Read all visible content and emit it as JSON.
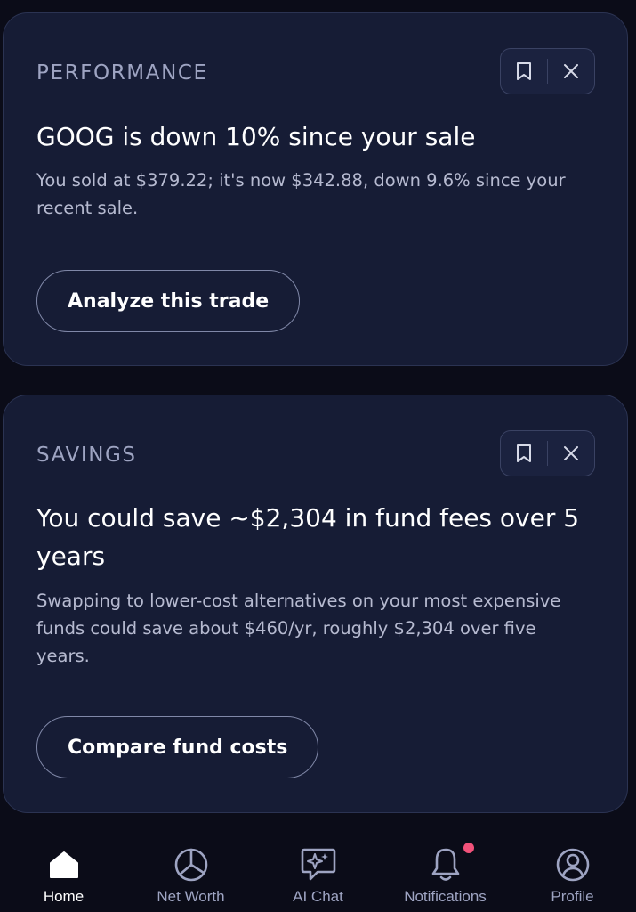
{
  "cards": [
    {
      "category": "PERFORMANCE",
      "title": "GOOG is down 10% since your sale",
      "body": "You sold at $379.22; it's now $342.88, down 9.6% since your recent sale.",
      "action_label": "Analyze this trade",
      "icons": [
        "bookmark-icon",
        "close-icon"
      ]
    },
    {
      "category": "SAVINGS",
      "title": "You could save ~$2,304 in fund fees over 5 years",
      "body": "Swapping to lower-cost alternatives on your most expensive funds could save about $460/yr, roughly $2,304 over five years.",
      "action_label": "Compare fund costs",
      "icons": [
        "bookmark-icon",
        "close-icon"
      ]
    }
  ],
  "tabbar": {
    "tabs": [
      {
        "label": "Home",
        "icon": "home-icon",
        "active": true
      },
      {
        "label": "Net Worth",
        "icon": "pie-chart-icon",
        "active": false
      },
      {
        "label": "AI Chat",
        "icon": "chat-sparkle-icon",
        "active": false
      },
      {
        "label": "Notifications",
        "icon": "bell-icon",
        "active": false,
        "badge": true
      },
      {
        "label": "Profile",
        "icon": "user-circle-icon",
        "active": false
      }
    ]
  },
  "colors": {
    "background": "#0b0c18",
    "card": "#161c35",
    "badge": "#f2527a",
    "text_primary": "#ffffff",
    "text_secondary": "#b6bad0"
  }
}
